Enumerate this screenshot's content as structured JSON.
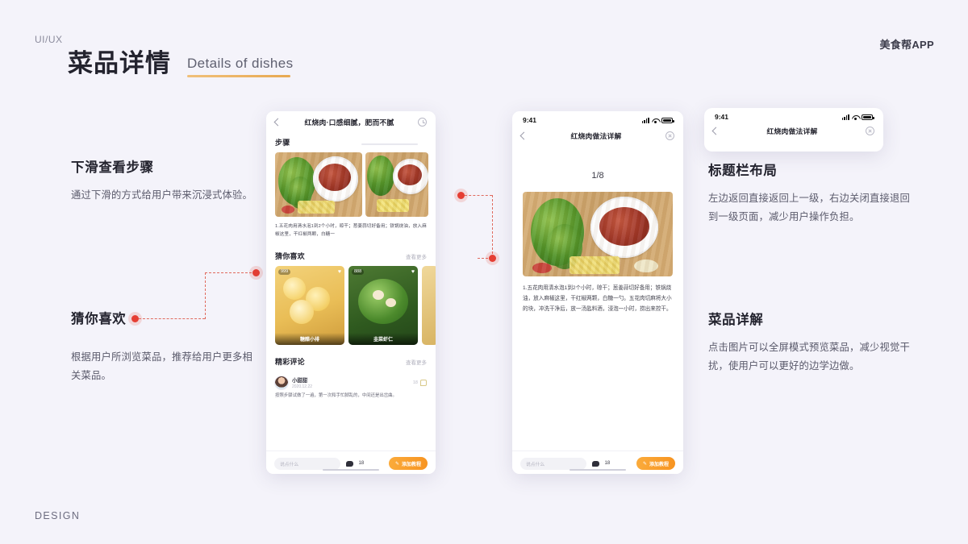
{
  "header": {
    "kicker": "UI/UX",
    "title_cn": "菜品详情",
    "title_en": "Details of dishes",
    "brand": "美食帮APP",
    "footer": "DESIGN"
  },
  "annotations": [
    {
      "id": "scroll-steps",
      "title": "下滑查看步骤",
      "body": "通过下滑的方式给用户带来沉浸式体验。"
    },
    {
      "id": "guess-you-like",
      "title": "猜你喜欢",
      "body": "根据用户所浏览菜品，推荐给用户更多相关菜品。"
    },
    {
      "id": "title-bar-layout",
      "title": "标题栏布局",
      "body": "左边返回直接返回上一级，右边关闭直接退回到一级页面，减少用户操作负担。"
    },
    {
      "id": "dish-detail",
      "title": "菜品详解",
      "body": "点击图片可以全屏模式预览菜品，减少视觉干扰，使用户可以更好的边学边做。"
    }
  ],
  "phone_detail": {
    "nav": {
      "title": "红烧肉·口感细腻，肥而不腻",
      "back_icon": "chevron-left-icon",
      "action_icon": "clock-history-icon"
    },
    "steps_section": {
      "title": "步骤"
    },
    "step_text": "1.五花肉用清水泡1到2个小时，晾干；葱姜蒜切好备用；铁锅烧油，放入麻椒这里，干红椒两颗，白糖一",
    "recommend_section": {
      "title": "猜你喜欢",
      "more": "查看更多",
      "cards": [
        {
          "label": "糖醋小排",
          "badge": "999"
        },
        {
          "label": "韭菜虾仁",
          "badge": "888"
        },
        {
          "label": "",
          "badge": ""
        }
      ]
    },
    "comments_section": {
      "title": "精彩评论",
      "more": "查看更多",
      "comment": {
        "name": "小甜甜",
        "date": "2020.12.22",
        "likes": "18",
        "body": "按照步骤试做了一遍，第一次和手忙脚乱的，中间还是出岔曲。"
      }
    },
    "bottom_bar": {
      "input_placeholder": "说点什么",
      "comment_count": "18",
      "cta_label": "添加教程"
    }
  },
  "phone_fullscreen": {
    "status": {
      "time": "9:41"
    },
    "nav": {
      "title": "红烧肉做法详解",
      "back_icon": "chevron-left-icon",
      "close_icon": "close-circle-icon"
    },
    "page_indicator": "1/8",
    "step_text": "1.五花肉用清水泡1到2个小时，晾干；葱姜蒜切好备用；铁锅烧油，放入麻椒这里，干红椒两颗，白糖一勺。五花肉切麻将大小的块，冲洗干净后，放一汤匙料酒，浸泡一小时，捞出来控干。",
    "bottom_bar": {
      "input_placeholder": "说点什么",
      "comment_count": "18",
      "cta_label": "添加教程"
    }
  },
  "phone_navbar_inset": {
    "status": {
      "time": "9:41"
    },
    "nav": {
      "title": "红烧肉做法详解",
      "back_icon": "chevron-left-icon",
      "close_icon": "close-circle-icon"
    }
  },
  "colors": {
    "background": "#f4f3fa",
    "accent_orange": "#e8a951",
    "connector_red": "#e53e34",
    "cta_orange": "#f79421",
    "text_dark": "#23232e"
  }
}
